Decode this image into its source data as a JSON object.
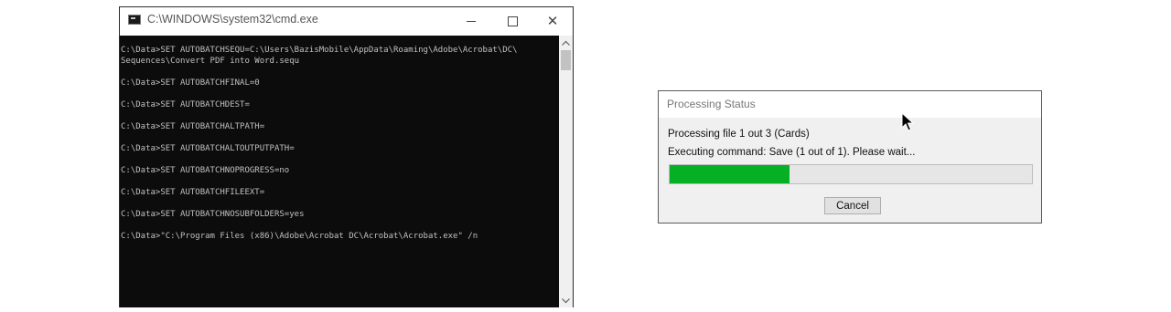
{
  "cmd_window": {
    "title": "C:\\WINDOWS\\system32\\cmd.exe",
    "icon": "cmd-app-icon",
    "controls": {
      "minimize_icon": "minimize-icon",
      "maximize_icon": "maximize-icon",
      "close_icon": "close-icon",
      "close_glyph": "✕"
    },
    "console_lines": [
      "C:\\Data>SET AUTOBATCHSEQU=C:\\Users\\BazisMobile\\AppData\\Roaming\\Adobe\\Acrobat\\DC\\",
      "Sequences\\Convert PDF into Word.sequ",
      "",
      "C:\\Data>SET AUTOBATCHFINAL=0",
      "",
      "C:\\Data>SET AUTOBATCHDEST=",
      "",
      "C:\\Data>SET AUTOBATCHALTPATH=",
      "",
      "C:\\Data>SET AUTOBATCHALTOUTPUTPATH=",
      "",
      "C:\\Data>SET AUTOBATCHNOPROGRESS=no",
      "",
      "C:\\Data>SET AUTOBATCHFILEEXT=",
      "",
      "C:\\Data>SET AUTOBATCHNOSUBFOLDERS=yes",
      "",
      "C:\\Data>\"C:\\Program Files (x86)\\Adobe\\Acrobat DC\\Acrobat\\Acrobat.exe\" /n"
    ],
    "scrollbar": {
      "up_glyph": "^",
      "down_glyph": "v"
    }
  },
  "dialog": {
    "title": "Processing Status",
    "status_line": "Processing file 1 out 3 (Cards)",
    "command_line": "Executing command: Save (1 out of 1). Please wait...",
    "progress": 0.33,
    "progress_color": "#06b025",
    "cancel_label": "Cancel"
  },
  "cursor": {
    "icon": "mouse-pointer-icon"
  }
}
